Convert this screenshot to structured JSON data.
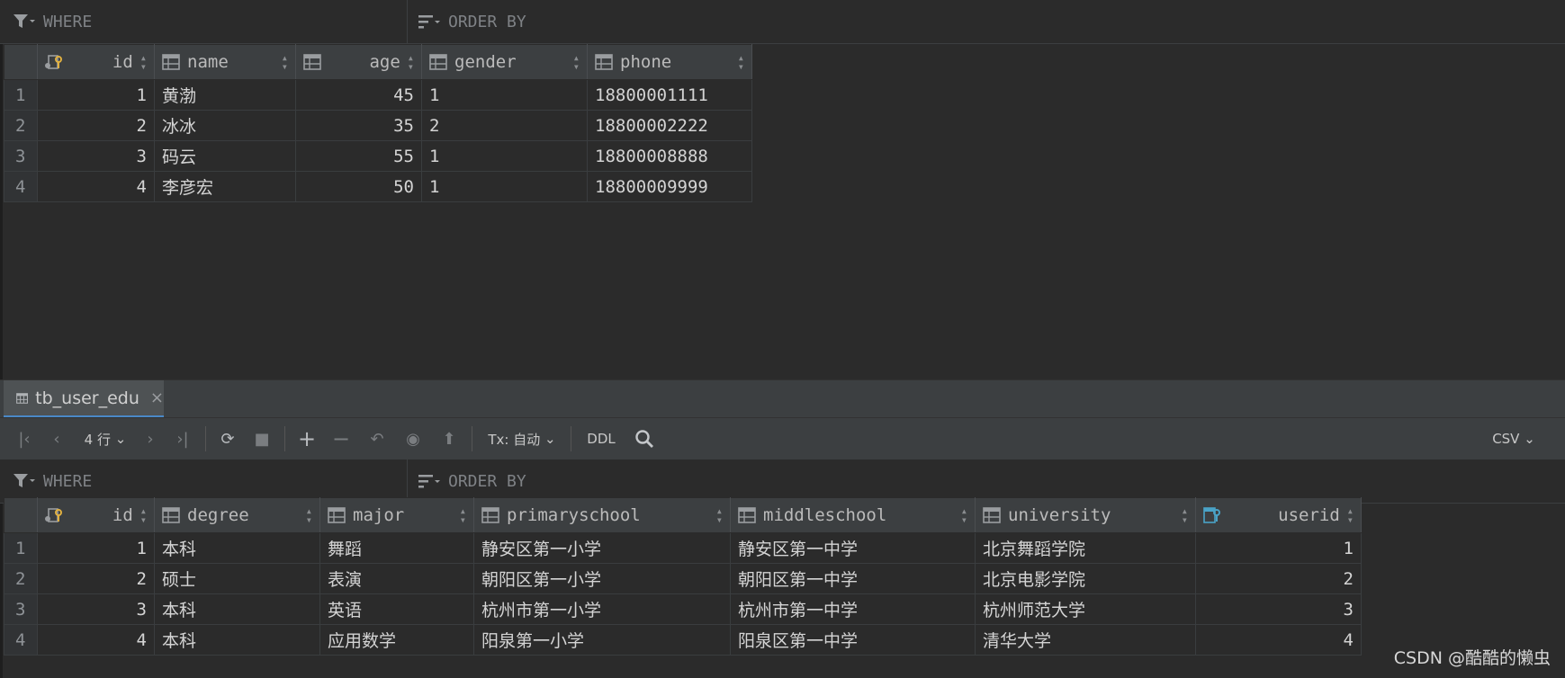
{
  "filter": {
    "where": "WHERE",
    "order_by": "ORDER BY"
  },
  "users": {
    "columns": [
      "id",
      "name",
      "age",
      "gender",
      "phone"
    ],
    "rows": [
      [
        "1",
        "1",
        "黄渤",
        "45",
        "1",
        "18800001111"
      ],
      [
        "2",
        "2",
        "冰冰",
        "35",
        "2",
        "18800002222"
      ],
      [
        "3",
        "3",
        "码云",
        "55",
        "1",
        "18800008888"
      ],
      [
        "4",
        "4",
        "李彦宏",
        "50",
        "1",
        "18800009999"
      ]
    ]
  },
  "tab": {
    "label": "tb_user_edu",
    "close": "×"
  },
  "toolbar": {
    "rows_label": "4 行",
    "tx_label": "Tx: 自动",
    "ddl_label": "DDL",
    "export_label": "CSV"
  },
  "edu": {
    "columns": [
      "id",
      "degree",
      "major",
      "primaryschool",
      "middleschool",
      "university",
      "userid"
    ],
    "rows": [
      [
        "1",
        "1",
        "本科",
        "舞蹈",
        "静安区第一小学",
        "静安区第一中学",
        "北京舞蹈学院",
        "1"
      ],
      [
        "2",
        "2",
        "硕士",
        "表演",
        "朝阳区第一小学",
        "朝阳区第一中学",
        "北京电影学院",
        "2"
      ],
      [
        "3",
        "3",
        "本科",
        "英语",
        "杭州市第一小学",
        "杭州市第一中学",
        "杭州师范大学",
        "3"
      ],
      [
        "4",
        "4",
        "本科",
        "应用数学",
        "阳泉第一小学",
        "阳泉区第一中学",
        "清华大学",
        "4"
      ]
    ]
  },
  "watermark": "CSDN @酷酷的懒虫"
}
